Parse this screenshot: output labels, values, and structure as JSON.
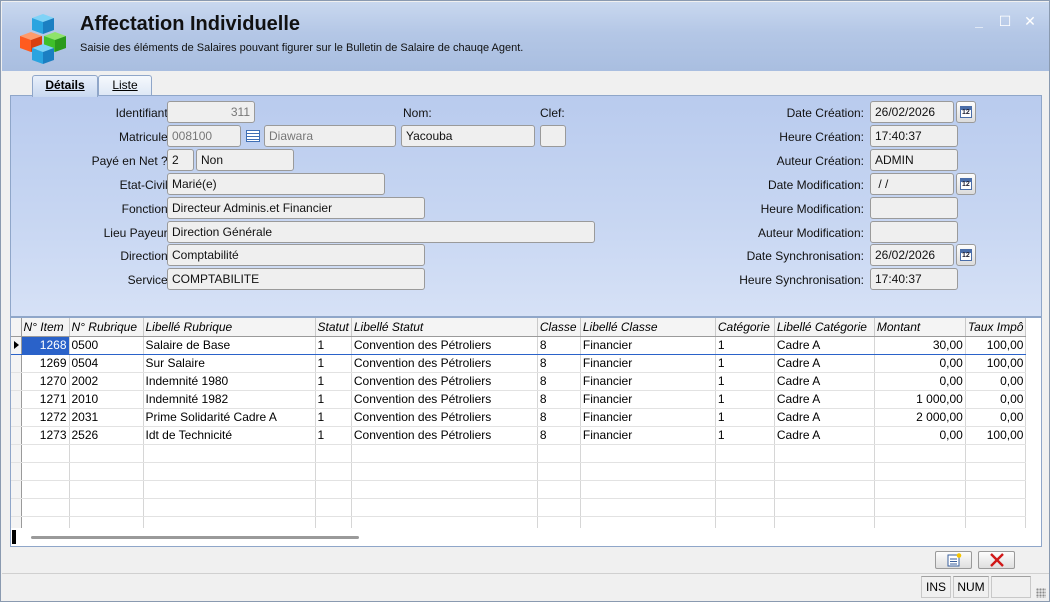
{
  "window": {
    "title": "Affectation Individuelle",
    "subtitle": "Saisie des éléments de Salaires pouvant figurer sur le Bulletin de Salaire de chauqe Agent.",
    "minimize": "_",
    "maximize": "☐",
    "close": "✕"
  },
  "tabs": [
    {
      "label": "Détails",
      "active": true
    },
    {
      "label": "Liste",
      "active": false
    }
  ],
  "form": {
    "identifiant": {
      "label": "Identifiant:",
      "value": "311"
    },
    "nom": {
      "label": "Nom:"
    },
    "clef": {
      "label": "Clef:",
      "value": ""
    },
    "matricule": {
      "label": "Matricule:",
      "value": "008100",
      "nom": "Diawara",
      "prenom": "Yacouba"
    },
    "paye_en_net": {
      "label": "Payé en Net ?:",
      "code": "2",
      "value": "Non"
    },
    "etat_civil": {
      "label": "Etat-Civil:",
      "value": "Marié(e)"
    },
    "fonction": {
      "label": "Fonction:",
      "value": "Directeur Adminis.et Financier"
    },
    "lieu_payeur": {
      "label": "Lieu Payeur:",
      "value": "Direction Générale"
    },
    "direction": {
      "label": "Direction:",
      "value": "Comptabilité"
    },
    "service": {
      "label": "Service:",
      "value": "COMPTABILITE"
    },
    "date_creation": {
      "label": "Date Création:",
      "value": "26/02/2026"
    },
    "heure_creation": {
      "label": "Heure Création:",
      "value": "17:40:37"
    },
    "auteur_creation": {
      "label": "Auteur Création:",
      "value": "ADMIN"
    },
    "date_modification": {
      "label": "Date Modification:",
      "value": " / /"
    },
    "heure_modification": {
      "label": "Heure Modification:",
      "value": ""
    },
    "auteur_modification": {
      "label": "Auteur Modification:",
      "value": ""
    },
    "date_synchronisation": {
      "label": "Date Synchronisation:",
      "value": "26/02/2026"
    },
    "heure_synchronisation": {
      "label": "Heure Synchronisation:",
      "value": "17:40:37"
    }
  },
  "grid": {
    "columns": [
      "N° Item",
      "N° Rubrique",
      "Libellé Rubrique",
      "Statut",
      "Libellé Statut",
      "Classe",
      "Libellé Classe",
      "Catégorie",
      "Libellé Catégorie",
      "Montant",
      "Taux Impô"
    ],
    "rows": [
      [
        "1268",
        "0500",
        "Salaire de Base",
        "1",
        "Convention des Pétroliers",
        "8",
        "Financier",
        "1",
        "Cadre A",
        "30,00",
        "100,00"
      ],
      [
        "1269",
        "0504",
        "Sur Salaire",
        "1",
        "Convention des Pétroliers",
        "8",
        "Financier",
        "1",
        "Cadre A",
        "0,00",
        "100,00"
      ],
      [
        "1270",
        "2002",
        "Indemnité 1980",
        "1",
        "Convention des Pétroliers",
        "8",
        "Financier",
        "1",
        "Cadre A",
        "0,00",
        "0,00"
      ],
      [
        "1271",
        "2010",
        "Indemnité 1982",
        "1",
        "Convention des Pétroliers",
        "8",
        "Financier",
        "1",
        "Cadre A",
        "1 000,00",
        "0,00"
      ],
      [
        "1272",
        "2031",
        "Prime Solidarité Cadre A",
        "1",
        "Convention des Pétroliers",
        "8",
        "Financier",
        "1",
        "Cadre A",
        "2 000,00",
        "0,00"
      ],
      [
        "1273",
        "2526",
        "Idt de Technicité",
        "1",
        "Convention des Pétroliers",
        "8",
        "Financier",
        "1",
        "Cadre A",
        "0,00",
        "100,00"
      ]
    ],
    "selected_row": 0,
    "empty_rows": 5
  },
  "status": {
    "ins": "INS",
    "num": "NUM"
  },
  "colors": {
    "header_bg": "#b4c7e6",
    "panel_bg": "#c7d6f2",
    "selection": "#2a62c9",
    "delete_icon": "#d01818"
  }
}
